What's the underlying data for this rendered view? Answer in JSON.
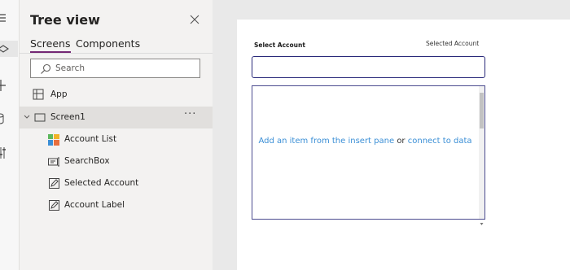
{
  "rail": {
    "icons": [
      "menu-icon",
      "layers-icon",
      "plus-icon",
      "database-icon",
      "controls-icon"
    ]
  },
  "tree": {
    "title": "Tree view",
    "tabs": {
      "screens": "Screens",
      "components": "Components"
    },
    "search": {
      "placeholder": "Search",
      "value": ""
    },
    "items": {
      "app": "App",
      "screen1": "Screen1",
      "account_list": "Account List",
      "search_box": "SearchBox",
      "selected_account": "Selected Account",
      "account_label": "Account Label"
    },
    "more_label": "···"
  },
  "screen": {
    "select_label": "Select Account",
    "selected_label": "Selected Account",
    "input_value": "",
    "gallery": {
      "link_insert": "Add an item from the insert pane",
      "or_text": "or",
      "link_connect": "connect to data"
    }
  },
  "colors": {
    "accent": "#742774",
    "link": "#3b8fd6",
    "input_border": "#2a2a7a"
  }
}
